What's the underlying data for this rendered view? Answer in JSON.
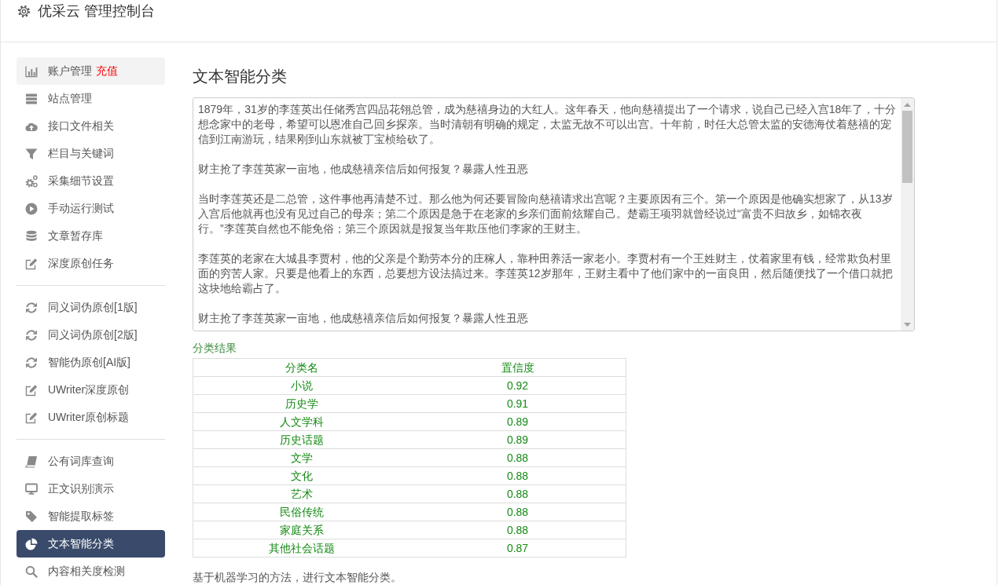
{
  "header": {
    "title": "优采云 管理控制台"
  },
  "sidebar": {
    "groups": [
      {
        "items": [
          {
            "label": "账户管理",
            "link": "充值",
            "selected": false,
            "hovered": true
          },
          {
            "label": "站点管理",
            "selected": false,
            "hovered": false
          },
          {
            "label": "接口文件相关",
            "selected": false,
            "hovered": false
          },
          {
            "label": "栏目与关键词",
            "selected": false,
            "hovered": false
          },
          {
            "label": "采集细节设置",
            "selected": false,
            "hovered": false
          },
          {
            "label": "手动运行测试",
            "selected": false,
            "hovered": false
          },
          {
            "label": "文章暂存库",
            "selected": false,
            "hovered": false
          },
          {
            "label": "深度原创任务",
            "selected": false,
            "hovered": false
          }
        ]
      },
      {
        "items": [
          {
            "label": "同义词伪原创[1版]",
            "selected": false,
            "hovered": false
          },
          {
            "label": "同义词伪原创[2版]",
            "selected": false,
            "hovered": false
          },
          {
            "label": "智能伪原创[AI版]",
            "selected": false,
            "hovered": false
          },
          {
            "label": "UWriter深度原创",
            "selected": false,
            "hovered": false
          },
          {
            "label": "UWriter原创标题",
            "selected": false,
            "hovered": false
          }
        ]
      },
      {
        "items": [
          {
            "label": "公有词库查询",
            "selected": false,
            "hovered": false
          },
          {
            "label": "正文识别演示",
            "selected": false,
            "hovered": false
          },
          {
            "label": "智能提取标签",
            "selected": false,
            "hovered": false
          },
          {
            "label": "文本智能分类",
            "selected": true,
            "hovered": false
          },
          {
            "label": "内容相关度检测",
            "selected": false,
            "hovered": false
          }
        ]
      }
    ]
  },
  "main": {
    "title": "文本智能分类",
    "text_input": {
      "value": [
        "1879年，31岁的李莲英出任储秀宫四品花翎总管，成为慈禧身边的大红人。这年春天，他向慈禧提出了一个请求，说自己已经入宫18年了，十分想念家中的老母，希望可以恩准自己回乡探亲。当时清朝有明确的规定，太监无故不可以出宫。十年前，时任大总管太监的安德海仗着慈禧的宠信到江南游玩，结果刚到山东就被丁宝桢给砍了。",
        "财主抢了李莲英家一亩地，他成慈禧亲信后如何报复？暴露人性丑恶",
        "当时李莲英还是二总管，这件事他再清楚不过。那么他为何还要冒险向慈禧请求出宫呢？主要原因有三个。第一个原因是他确实想家了，从13岁入宫后他就再也没有见过自己的母亲；第二个原因是急于在老家的乡亲们面前炫耀自己。楚霸王项羽就曾经说过“富贵不归故乡，如锦衣夜行。”李莲英自然也不能免俗；第三个原因就是报复当年欺压他们李家的王财主。",
        "李莲英的老家在大城县李贾村，他的父亲是个勤劳本分的庄稼人，靠种田养活一家老小。李贾村有一个王姓财主，仗着家里有钱，经常欺负村里面的穷苦人家。只要是他看上的东西，总要想方设法搞过来。李莲英12岁那年，王财主看中了他们家中的一亩良田，然后随便找了一个借口就把这块地给霸占了。",
        "财主抢了李莲英家一亩地，他成慈禧亲信后如何报复？暴露人性丑恶"
      ]
    },
    "results": {
      "label": "分类结果",
      "columns": [
        "分类名",
        "置信度"
      ],
      "rows": [
        [
          "小说",
          "0.92"
        ],
        [
          "历史学",
          "0.91"
        ],
        [
          "人文学科",
          "0.89"
        ],
        [
          "历史话题",
          "0.89"
        ],
        [
          "文学",
          "0.88"
        ],
        [
          "文化",
          "0.88"
        ],
        [
          "艺术",
          "0.88"
        ],
        [
          "民俗传统",
          "0.88"
        ],
        [
          "家庭关系",
          "0.88"
        ],
        [
          "其他社会话题",
          "0.87"
        ]
      ]
    },
    "note": "基于机器学习的方法，进行文本智能分类。"
  }
}
